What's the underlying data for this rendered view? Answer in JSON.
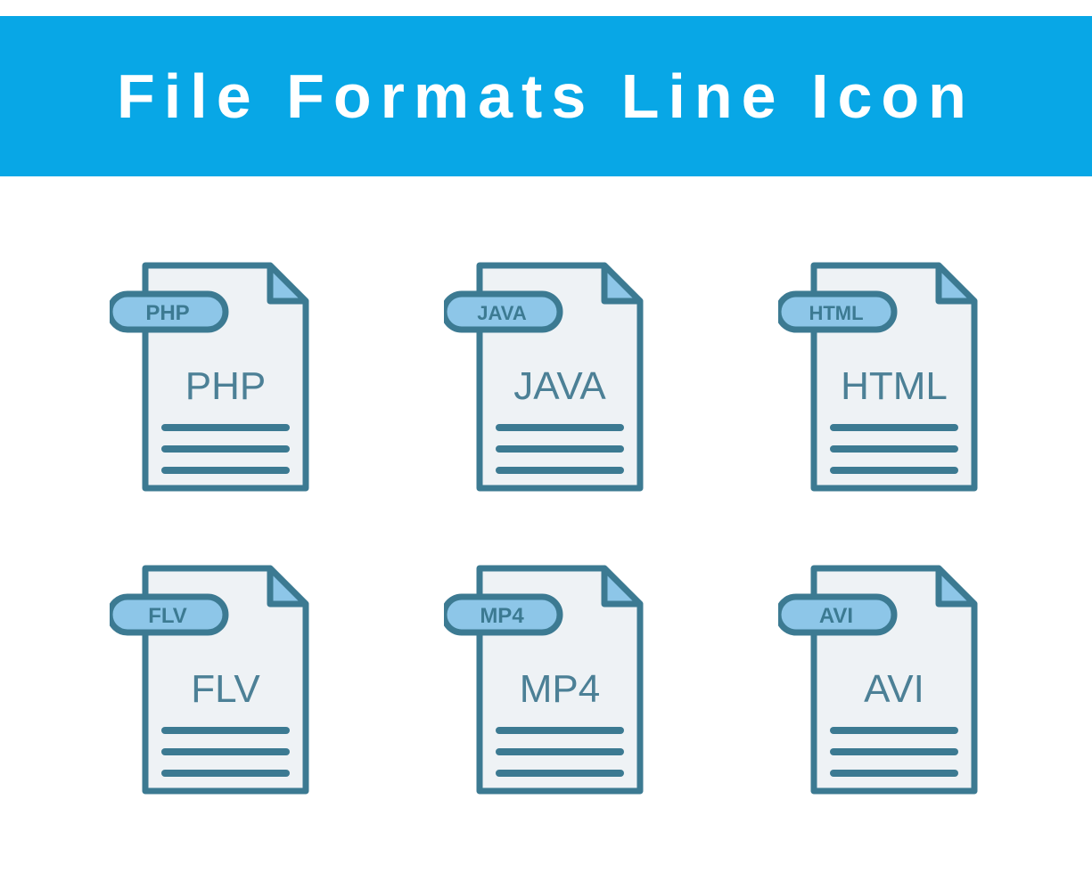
{
  "header": {
    "title": "File Formats Line Icon"
  },
  "icons": [
    {
      "tag": "PHP",
      "label": "PHP"
    },
    {
      "tag": "JAVA",
      "label": "JAVA"
    },
    {
      "tag": "HTML",
      "label": "HTML"
    },
    {
      "tag": "FLV",
      "label": "FLV"
    },
    {
      "tag": "MP4",
      "label": "MP4"
    },
    {
      "tag": "AVI",
      "label": "AVI"
    }
  ],
  "colors": {
    "header_bg": "#08a7e6",
    "stroke": "#3c7a92",
    "page_fill": "#eef2f5",
    "fold_fill": "#8dc6e8",
    "tag_fill": "#8dc6e8",
    "text": "#4c8096"
  }
}
